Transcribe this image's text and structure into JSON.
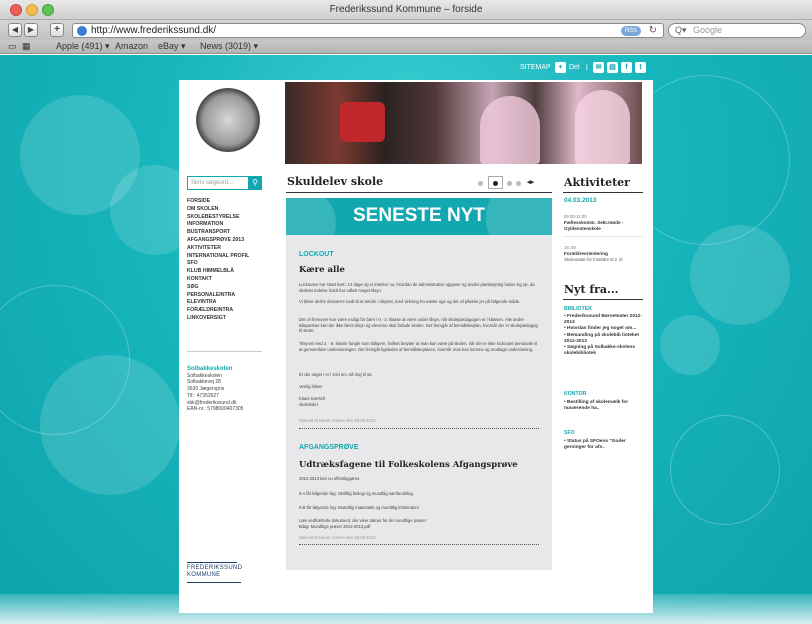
{
  "browser": {
    "window_title": "Frederikssund Kommune – forside",
    "url": "http://www.frederikssund.dk/",
    "rss_label": "RSS",
    "search_placeholder": "Google",
    "bookmarks": [
      "Apple (491) ▾",
      "Amazon",
      "eBay ▾",
      "News (3019) ▾"
    ]
  },
  "topbar": {
    "sitemap": "SITEMAP",
    "share_label": "Del"
  },
  "sidebar": {
    "search_placeholder": "Skriv søgeord...",
    "nav": [
      "FORSIDE",
      "OM SKOLEN",
      "SKOLEBESTYRELSE",
      "INFORMATION",
      "BUSTRANSPORT",
      "AFGANGSPRØVE 2013",
      "AKTIVITETER",
      "INTERNATIONAL PROFIL",
      "SFO",
      "KLUB HIMMELBLÅ",
      "KONTAKT",
      "SØG",
      "PERSONALEINTRA",
      "ELEVINTRA",
      "FORÆLDREINTRA",
      "LINKOVERSIGT"
    ],
    "school_name": "Solbakkeskolen",
    "address_lines": [
      "Solbakkeskolen",
      "Solbakkevej 28",
      "3630 Jægerspris",
      "Tlf.: 47352627",
      "sbk@frederikssund.dk",
      "EAN-nr.: 5798000407305"
    ],
    "footer_logo_line1": "FREDERIKSSUND",
    "footer_logo_line2": "KOMMUNE"
  },
  "main": {
    "title": "Skuldelev skole",
    "banner": "SENESTE NYT",
    "article1": {
      "section": "LOCKOUT",
      "title": "Kære alle",
      "paragraphs": [
        "Lockouten har snart kørt i 14 dage og vi mærker nu, hvordan de administrative opgaver og anden planlægning hober sig op, da skolens ledelse holdt har udført meget tilsyn.",
        "Vi bliver derfor desværre nødt til at ændre i tilsynet, med virkning fra næste uge og det vil påvirke jer på følgende måde.",
        "Det vil fremover kun være muligt for børn i 0.- 2. klasse at være under tilsyn, når skolepædagogen er i klassen. Alle andre tidspunkter kan der ikke føres tilsyn og eleverne skal forlade skolen. Det fremgår af bemidlskeplan, hvornår der er skolepædagog til stede.",
        "Tilsynet med 3. - 9. klasse fungér som tidligere, hvilket betyder at man kan være på skolen, når der er ikke lockoutet personale til at gennemføre undervisningen. Det fremgår ligeledes af bemidlskeplanen, hvornår man kan komme og modtage undervisning.",
        "Er der noget I er i tvivl om, så ring til os.",
        "Venlig hilsen",
        "Klaus Kærsell\nskoleleder"
      ],
      "posted": "Skrevet af Naom Jensen den 28-08-2012"
    },
    "article2": {
      "section": "AFGANGSPRØVE",
      "title": "Udtræksfagene til Folkeskolens Afgangsprøve",
      "paragraphs": [
        "2012-2013 kan nu offentliggøres.",
        "9.A får følgende fag: Skriftlig biologi og mundtlig samfundsfag",
        "9.B får følgende fag: Mundtlig matematik og mundtlig kristendom",
        "Læs vedhæftede dokument, der viser datoer for de mundtlige prøver:\nBilag: Mundtlige prøver 2012-2013.pdf"
      ],
      "posted": "Skrevet af Naom Jensen den 28-08-2012"
    }
  },
  "right": {
    "activities_title": "Aktiviteter",
    "date": "04.03.2013",
    "events": [
      {
        "time": "09:00-11:00",
        "title": "Fællesskomm. Sekr.møde - Gyldenstenskole",
        "desc": ""
      },
      {
        "time": "16.:00",
        "title": "Forældreorientering",
        "desc": "Skolemøde for forældre til 2. kl"
      }
    ],
    "news_title": "Nyt fra...",
    "categories": [
      {
        "name": "BIBLIOTEK",
        "items": [
          "• Frederikssund Børneteater 2012-2013",
          "• Hvordan finder jeg noget om...",
          "• Bemanding på skolebib lioteket 2012-2013",
          "• Søgning på Solbakke-skolens skolebibliotek"
        ]
      },
      {
        "name": "KONTOR",
        "items": [
          "• Bestilling af skolemælk for nuværende ha.."
        ]
      },
      {
        "name": "SFO",
        "items": [
          "• Status på SFOens \"Goder gerninger for afs.."
        ]
      }
    ]
  },
  "colors": {
    "accent": "#13a8b0",
    "background": "#17b5bc"
  }
}
